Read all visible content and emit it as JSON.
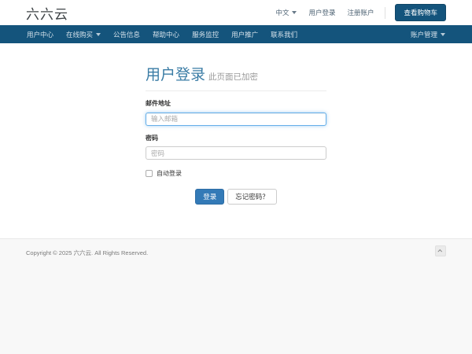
{
  "topbar": {
    "logo": "六六云",
    "language_menu": "中文",
    "login_link": "用户登录",
    "register_link": "注册账户",
    "cart_button": "查看购物车"
  },
  "navbar": {
    "items": [
      {
        "label": "用户中心",
        "has_dropdown": false
      },
      {
        "label": "在线购买",
        "has_dropdown": true
      },
      {
        "label": "公告信息",
        "has_dropdown": false
      },
      {
        "label": "帮助中心",
        "has_dropdown": false
      },
      {
        "label": "服务监控",
        "has_dropdown": false
      },
      {
        "label": "用户推广",
        "has_dropdown": false
      },
      {
        "label": "联系我们",
        "has_dropdown": false
      }
    ],
    "account_menu": "账户管理"
  },
  "login": {
    "title": "用户登录",
    "subtitle": "此页面已加密",
    "email_label": "邮件地址",
    "email_placeholder": "输入邮箱",
    "email_value": "",
    "password_label": "密码",
    "password_placeholder": "密码",
    "password_value": "",
    "remember_label": "自动登录",
    "remember_checked": false,
    "login_button": "登录",
    "forgot_button": "忘记密码？"
  },
  "footer": {
    "copyright": "Copyright © 2025 六六云. All Rights Reserved.",
    "scroll_top_icon": "chevron-up-icon"
  },
  "colors": {
    "navbar_bg": "#14547c",
    "primary_button": "#337ab7",
    "heading_accent": "#3a7ca5",
    "focus_border": "#66afe9",
    "footer_bg": "#f8f8f8"
  }
}
